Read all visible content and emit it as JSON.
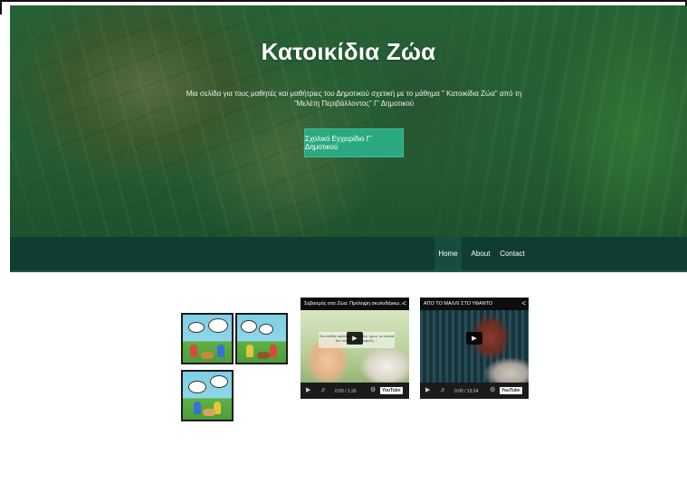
{
  "hero": {
    "title": "Κατοικίδια Ζώα",
    "subtitle": "Μια σελίδα για τους μαθητές και μαθήτριες του Δημοτικού σχετική με το μάθημα \" Κατοικίδια Ζώα\" από τη \"Μελέτη Περιβάλλοντος\" Γ' Δημοτικού",
    "button_label": "Σχολικό Εγχειρίδιο Γ' Δημοτικού"
  },
  "nav": {
    "items": [
      {
        "label": "Home",
        "active": true
      },
      {
        "label": "About",
        "active": false
      },
      {
        "label": "Contact",
        "active": false
      }
    ]
  },
  "gallery": {
    "images": [
      {
        "icon": "comic-image"
      },
      {
        "icon": "comic-image"
      },
      {
        "icon": "comic-image"
      }
    ]
  },
  "videos": [
    {
      "title": "Σεβασμός στα Ζώα: Πρόληψη σκυλοδάγκω...",
      "caption": "Στα παιδιά αρέσουν τα σκυλιά, όμως τα σκυλιά δεν είναι πάντα ασφαλή ...",
      "time": "0:00 / 1:26",
      "youtube_label": "YouTube"
    },
    {
      "title": "ΑΠΟ ΤΟ ΜΑΛΛΙ ΣΤΟ ΥΦΑΝΤΟ",
      "time": "0:00 / 13:24",
      "youtube_label": "YouTube"
    }
  ],
  "colors": {
    "accent_button": "#2aa981",
    "navbar": "#0f3d33",
    "nav_active": "#174c40"
  }
}
